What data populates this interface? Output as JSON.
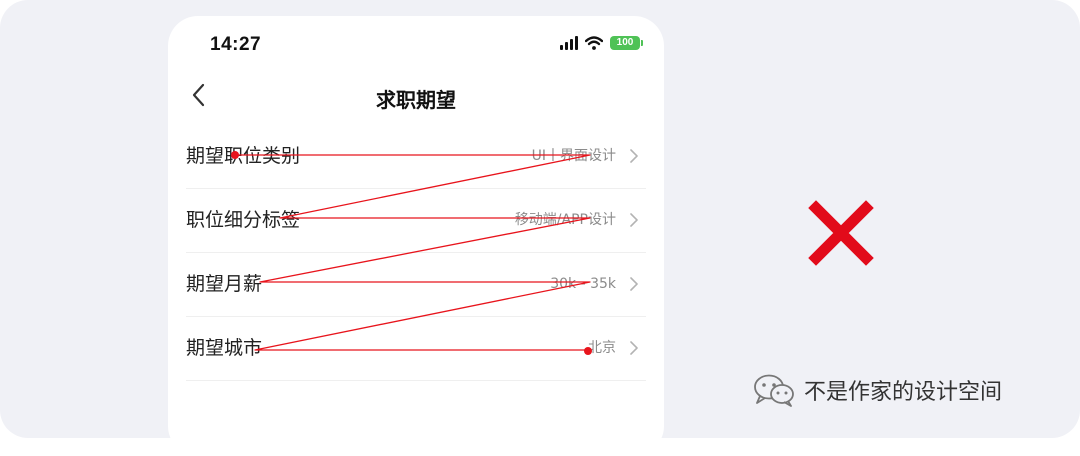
{
  "status_bar": {
    "time": "14:27",
    "battery": "100"
  },
  "nav": {
    "title": "求职期望"
  },
  "rows": [
    {
      "label": "期望职位类别",
      "value": "UI丨界面设计"
    },
    {
      "label": "职位细分标签",
      "value": "移动端/APP设计"
    },
    {
      "label": "期望月薪",
      "value": "30k - 35k"
    },
    {
      "label": "期望城市",
      "value": "北京"
    }
  ],
  "verdict": "wrong-x-icon",
  "watermark": {
    "text": "不是作家的设计空间",
    "icon": "wechat-icon"
  },
  "colors": {
    "annotation_line": "#e8141c",
    "wrong_mark": "#e20b1a",
    "battery": "#4fc256",
    "background": "#f0f1f6"
  }
}
